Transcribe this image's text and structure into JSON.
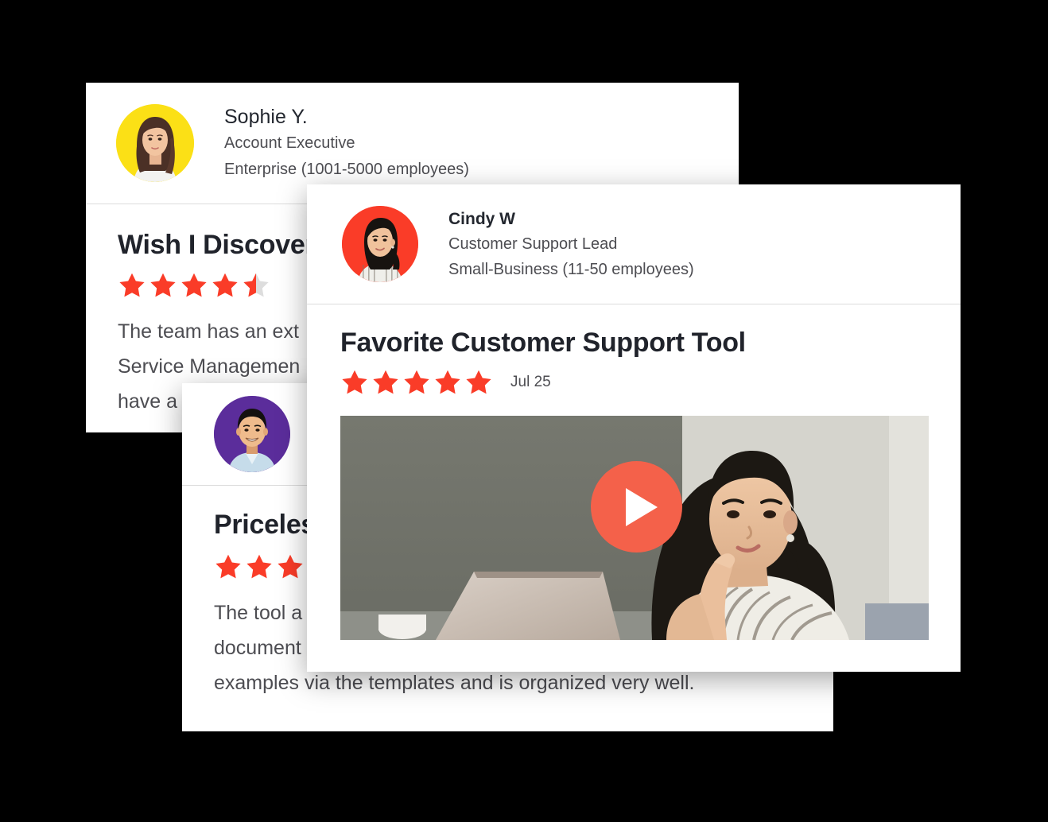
{
  "page": {
    "background_color": "#000000",
    "accent_star_color": "#FA3C28",
    "play_button_color": "#F4614A",
    "title_color": "#20232B",
    "body_text_color": "#4D4D52"
  },
  "cards": [
    {
      "id": "sophie",
      "reviewer": {
        "name": "Sophie Y.",
        "role": "Account Executive",
        "company_size": "Enterprise (1001-5000 employees)",
        "avatar_bg": "#FBE016",
        "avatar_alt": "photo of Sophie Y."
      },
      "review": {
        "title": "Wish I Discovered",
        "rating": 4.5,
        "rating_max": 5,
        "text_lines": [
          "The team has an ext",
          "Service Managemen",
          "have a"
        ]
      }
    },
    {
      "id": "cindy",
      "reviewer": {
        "name": "Cindy W",
        "role": "Customer Support Lead",
        "company_size": "Small-Business (11-50 employees)",
        "avatar_bg": "#FA3C28",
        "avatar_alt": "photo of Cindy W"
      },
      "review": {
        "title": "Favorite Customer Support Tool",
        "rating": 5,
        "rating_max": 5,
        "date": "Jul 25",
        "has_video": true,
        "video_alt": "woman at desk looking at a laptop"
      }
    },
    {
      "id": "priceless",
      "reviewer": {
        "avatar_bg": "#5B2D9B",
        "avatar_alt": "photo of smiling man in light blue shirt"
      },
      "review": {
        "title": "Priceless",
        "rating": 3,
        "rating_max": 5,
        "text_lines": [
          "The tool a",
          "document",
          "examples via the templates and is organized very well."
        ]
      }
    }
  ],
  "icons": {
    "star_full": "star-full-icon",
    "star_half": "star-half-icon",
    "play": "play-icon"
  }
}
